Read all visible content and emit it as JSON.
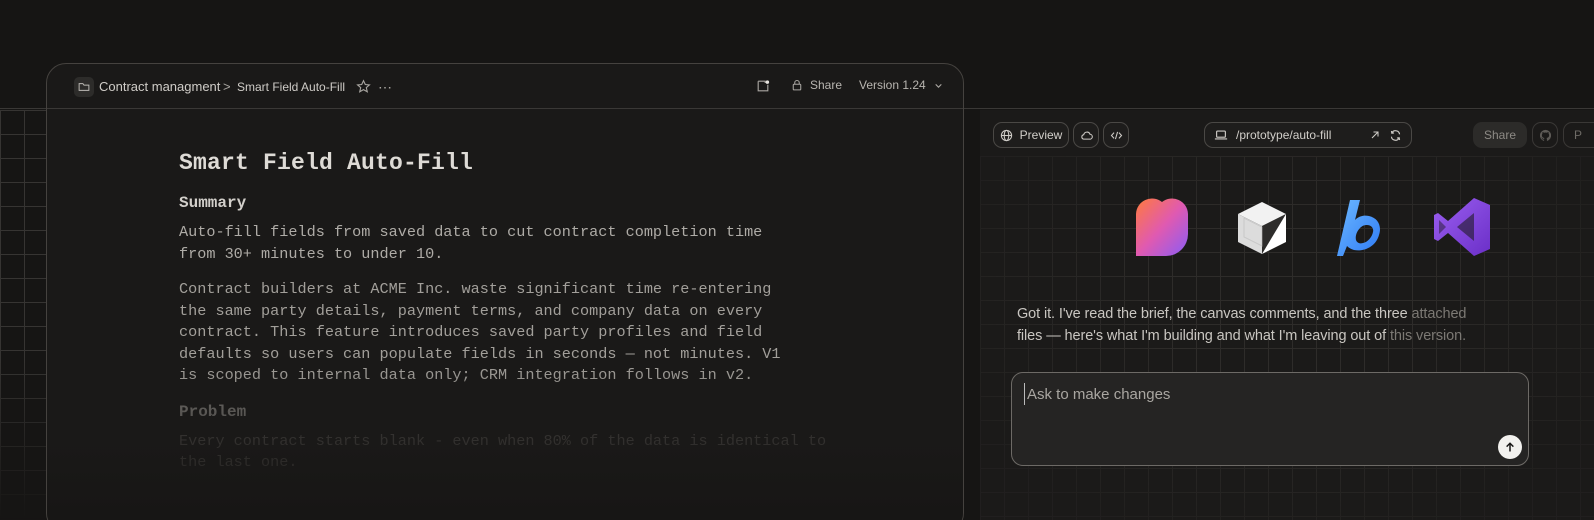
{
  "document": {
    "breadcrumb": {
      "parent": "Contract managment",
      "separator": ">",
      "current": "Smart Field Auto-Fill"
    },
    "header": {
      "share_label": "Share",
      "version_label": "Version 1.24"
    },
    "title": "Smart Field Auto-Fill",
    "summary_heading": "Summary",
    "summary_text": "Auto-fill fields from saved data to cut contract completion time\nfrom 30+ minutes to under 10.",
    "details_text": "Contract builders at ACME Inc. waste significant time re-entering\nthe same party details, payment terms, and company data on every\ncontract. This feature introduces saved party profiles and field\ndefaults so users can populate fields in seconds — not minutes. V1\nis scoped to internal data only; CRM integration follows in v2.",
    "problem_heading": "Problem",
    "problem_text": "Every contract starts blank - even when 80% of the data is identical to the last one."
  },
  "preview": {
    "toolbar": {
      "preview_label": "Preview",
      "url": "/prototype/auto-fill",
      "share_label": "Share",
      "cut_label": "P"
    },
    "logos": [
      "heart-logo-icon",
      "cube-logo-icon",
      "bolt-b-logo-icon",
      "visual-studio-logo-icon"
    ],
    "message": {
      "text_main": "Got it. I've read the brief, the canvas comments, and the three",
      "text_fade_1": " attached",
      "text_line2": "files — here's what I'm building and what I'm leaving out of",
      "text_fade_2": " this version."
    },
    "chat": {
      "placeholder": "Ask to make changes"
    }
  },
  "colors": {
    "background": "#161514",
    "panel": "#1b1a19",
    "window": "#1a1918",
    "border": "#45423f",
    "send_button": "#f2f1ee"
  }
}
